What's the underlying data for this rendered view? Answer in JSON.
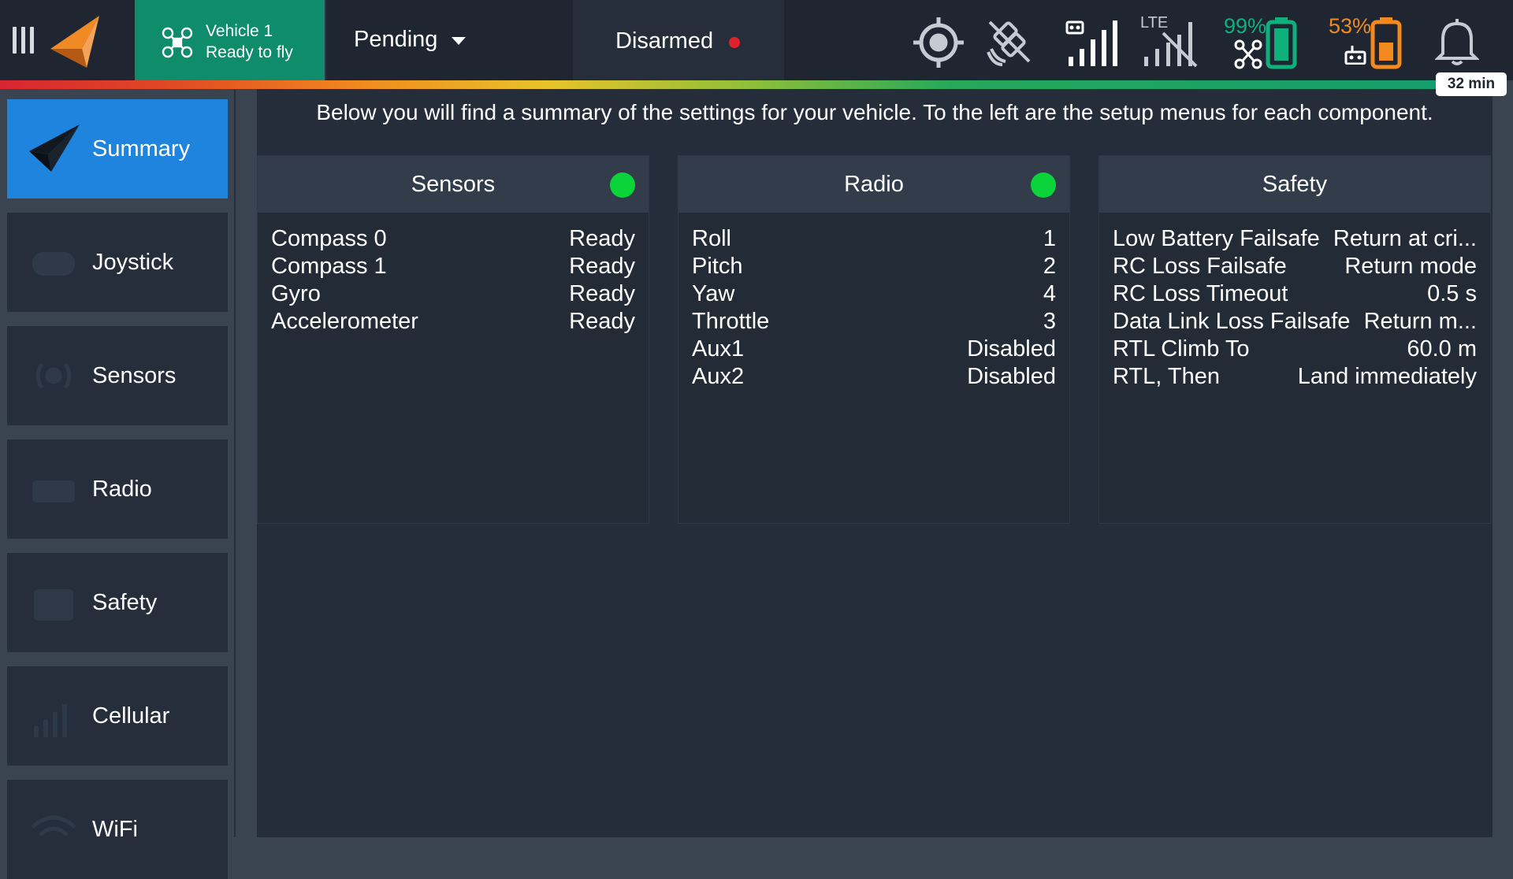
{
  "topbar": {
    "vehicle_name": "Vehicle 1",
    "vehicle_status": "Ready to fly",
    "flight_mode": "Pending",
    "arm_state": "Disarmed",
    "arm_state_color": "#e0202a",
    "signal_label": "LTE",
    "vehicle_battery_pct": "99%",
    "vehicle_battery_color": "#10b07c",
    "rc_battery_pct": "53%",
    "rc_battery_color": "#f28a1f",
    "flight_time": "32 min",
    "icons": [
      "menu-icon",
      "app-logo-icon",
      "drone-icon",
      "gps-target-icon",
      "satellite-off-icon",
      "rc-signal-icon",
      "lte-signal-off-icon",
      "drone-battery-icon",
      "rc-battery-icon",
      "bell-icon"
    ]
  },
  "sidebar": {
    "items": [
      {
        "label": "Summary",
        "icon": "paper-plane-icon",
        "active": true
      },
      {
        "label": "Joystick",
        "icon": "gamepad-icon"
      },
      {
        "label": "Sensors",
        "icon": "sensor-icon"
      },
      {
        "label": "Radio",
        "icon": "radio-icon"
      },
      {
        "label": "Safety",
        "icon": "first-aid-icon"
      },
      {
        "label": "Cellular",
        "icon": "cellular-icon"
      },
      {
        "label": "WiFi",
        "icon": "wifi-icon"
      }
    ]
  },
  "main": {
    "description": "Below you will find a summary of the settings for your vehicle. To the left are the setup menus for each component.",
    "cards": [
      {
        "title": "Sensors",
        "status_color": "#0bd33a",
        "rows": [
          {
            "k": "Compass 0",
            "v": "Ready"
          },
          {
            "k": "Compass 1",
            "v": "Ready"
          },
          {
            "k": "Gyro",
            "v": "Ready"
          },
          {
            "k": "Accelerometer",
            "v": "Ready"
          }
        ]
      },
      {
        "title": "Radio",
        "status_color": "#0bd33a",
        "rows": [
          {
            "k": "Roll",
            "v": "1"
          },
          {
            "k": "Pitch",
            "v": "2"
          },
          {
            "k": "Yaw",
            "v": "4"
          },
          {
            "k": "Throttle",
            "v": "3"
          },
          {
            "k": "Aux1",
            "v": "Disabled"
          },
          {
            "k": "Aux2",
            "v": "Disabled"
          }
        ]
      },
      {
        "title": "Safety",
        "rows": [
          {
            "k": "Low Battery Failsafe",
            "v": "Return at cri..."
          },
          {
            "k": "RC Loss Failsafe",
            "v": "Return mode"
          },
          {
            "k": "RC Loss Timeout",
            "v": "0.5 s"
          },
          {
            "k": "Data Link Loss Failsafe",
            "v": "Return m..."
          },
          {
            "k": "RTL Climb To",
            "v": "60.0 m"
          },
          {
            "k": "RTL, Then",
            "v": "Land immediately"
          }
        ]
      }
    ]
  }
}
